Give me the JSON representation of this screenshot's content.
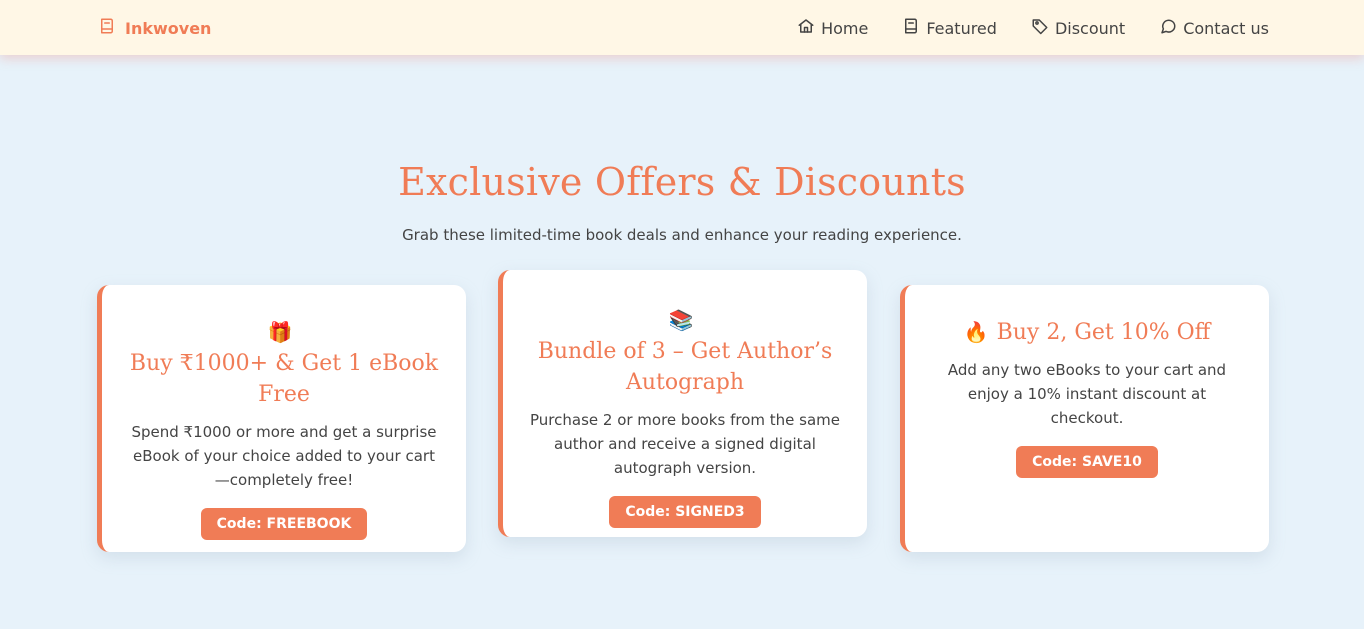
{
  "nav": {
    "brand": "Inkwoven",
    "links": [
      {
        "label": "Home",
        "icon": "home-icon"
      },
      {
        "label": "Featured",
        "icon": "book-icon"
      },
      {
        "label": "Discount",
        "icon": "tag-icon"
      },
      {
        "label": "Contact us",
        "icon": "chat-icon"
      }
    ]
  },
  "hero": {
    "title": "Exclusive Offers & Discounts",
    "subtitle": "Grab these limited-time book deals and enhance your reading experience."
  },
  "offers": [
    {
      "icon": "🎁",
      "title": "Buy ₹1000+ & Get 1 eBook Free",
      "description": "Spend ₹1000 or more and get a surprise eBook of your choice added to your cart —completely free!",
      "code": "Code: FREEBOOK"
    },
    {
      "icon": "📚",
      "title": "Bundle of 3 – Get Author’s Autograph",
      "description": "Purchase 2 or more books from the same author and receive a signed digital autograph version.",
      "code": "Code: SIGNED3"
    },
    {
      "icon": "🔥",
      "title": "Buy 2, Get 10% Off",
      "description": "Add any two eBooks to your cart and enjoy a 10% instant discount at checkout.",
      "code": "Code: SAVE10"
    }
  ],
  "colors": {
    "accent": "#f07c56",
    "navbar_bg": "#fff7e6",
    "page_bg": "#e7f2fa"
  }
}
